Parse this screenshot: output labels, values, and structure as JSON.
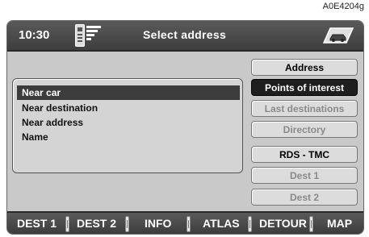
{
  "figure_id": "A0E4204g",
  "header": {
    "time": "10:30",
    "title": "Select address"
  },
  "list": {
    "items": [
      {
        "label": "Near car",
        "selected": true
      },
      {
        "label": "Near destination",
        "selected": false
      },
      {
        "label": "Near address",
        "selected": false
      },
      {
        "label": "Name",
        "selected": false
      }
    ]
  },
  "side_menu": {
    "items": [
      {
        "label": "Address",
        "state": "normal"
      },
      {
        "label": "Points of interest",
        "state": "active"
      },
      {
        "label": "Last destinations",
        "state": "disabled"
      },
      {
        "label": "Directory",
        "state": "disabled"
      },
      {
        "label": "RDS - TMC",
        "state": "normal"
      },
      {
        "label": "Dest 1",
        "state": "disabled"
      },
      {
        "label": "Dest 2",
        "state": "disabled"
      }
    ]
  },
  "bottom_bar": {
    "items": [
      {
        "label": "DEST 1"
      },
      {
        "label": "DEST 2"
      },
      {
        "label": "INFO"
      },
      {
        "label": "ATLAS"
      },
      {
        "label": "DETOUR"
      },
      {
        "label": "MAP"
      }
    ]
  },
  "colors": {
    "screen_bg": "#c9c9c9",
    "bar_bg": "#4a4a4a",
    "selected_bg": "#3c3c3c",
    "active_btn_bg": "#1e1e1e"
  },
  "icons": {
    "header_left": [
      "phone-icon",
      "signal-icon"
    ],
    "header_right": "car-icon"
  }
}
